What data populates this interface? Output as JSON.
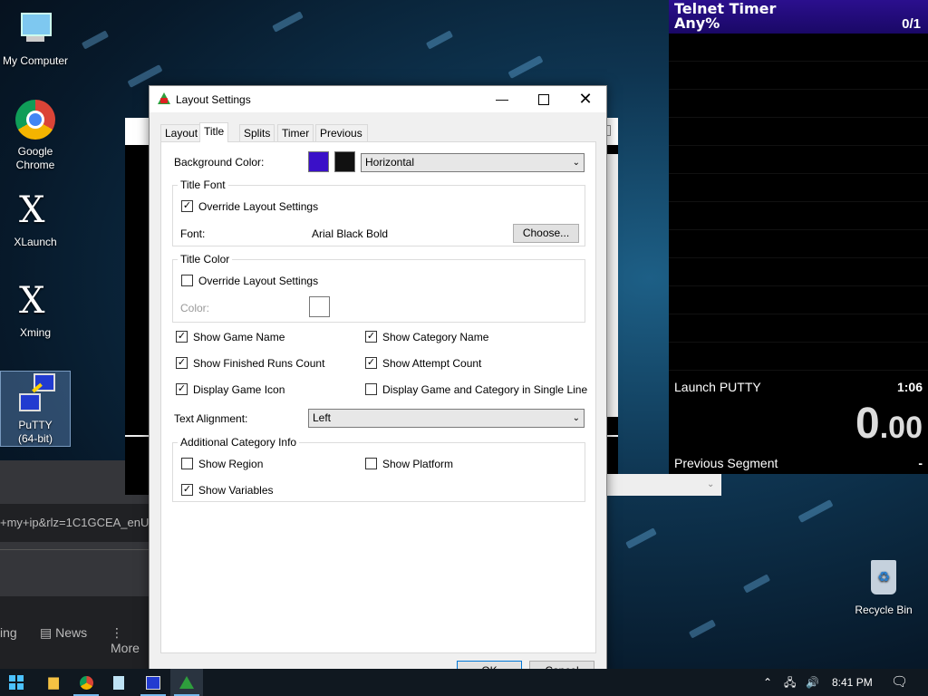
{
  "desktop": {
    "icons": [
      {
        "label": "My Computer"
      },
      {
        "label": "Google Chrome"
      },
      {
        "label": "XLaunch"
      },
      {
        "label": "Xming"
      },
      {
        "label": "PuTTY (64-bit)"
      },
      {
        "label": "Recycle Bin"
      }
    ]
  },
  "browser_fragments": {
    "address": "+my+ip&rlz=1C1GCEA_enU",
    "nav_partial": "ing",
    "news": "News",
    "more": "More"
  },
  "livesplit": {
    "game": "Telnet Timer",
    "category": "Any%",
    "attempts": "0/1",
    "split_name": "Launch PUTTY",
    "split_time": "1:06",
    "timer_main": "0",
    "timer_decimal": ".00",
    "prev_label": "Previous Segment",
    "prev_value": "-",
    "title_color": "#2b0f8e"
  },
  "dialog": {
    "title": "Layout Settings",
    "tabs": [
      "Layout",
      "Title",
      "Splits",
      "Timer",
      "Previous Segment"
    ],
    "active_tab": "Title",
    "background_color_label": "Background Color:",
    "bg_color1": "#3a10c8",
    "bg_color2": "#111111",
    "gradient_value": "Horizontal",
    "title_font_group": "Title Font",
    "override_font_label": "Override Layout Settings",
    "override_font_checked": true,
    "font_label": "Font:",
    "font_value": "Arial Black Bold",
    "choose_label": "Choose...",
    "title_color_group": "Title Color",
    "override_color_label": "Override Layout Settings",
    "override_color_checked": false,
    "color_label": "Color:",
    "show_game_name": "Show Game Name",
    "show_category_name": "Show Category Name",
    "show_finished_runs": "Show Finished Runs Count",
    "show_attempt_count": "Show Attempt Count",
    "display_game_icon": "Display Game Icon",
    "single_line": "Display Game and Category in Single Line",
    "text_alignment_label": "Text Alignment:",
    "text_alignment_value": "Left",
    "additional_group": "Additional Category Info",
    "show_region": "Show Region",
    "show_platform": "Show Platform",
    "show_variables": "Show Variables",
    "ok_label": "OK",
    "cancel_label": "Cancel"
  },
  "taskbar": {
    "time": "8:41 PM"
  }
}
